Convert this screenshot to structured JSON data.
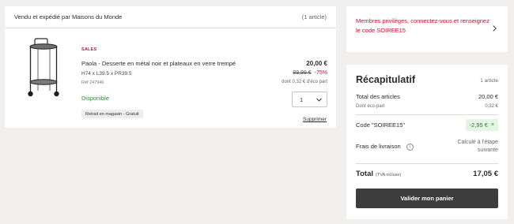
{
  "cart": {
    "seller": "Vendu et expédié par Maisons du Monde",
    "article_count": "(1 article)",
    "item": {
      "badge": "SALES",
      "name": "Paola - Desserte en métal noir et plateaux en verre trempé",
      "dimensions": "H74 x L39.5 x PR39.5",
      "reference": "Réf 247946",
      "availability": "Disponible",
      "pickup": "Retrait en magasin - Gratuit",
      "price": "20,00 €",
      "old_price": "89,99 €",
      "discount": "-75%",
      "eco_part": "dont 0,32 € d'éco part",
      "quantity": "1",
      "remove": "Supprimer"
    }
  },
  "promo": {
    "text": "Membres privilèges, connectez-vous et renseignez le code SOIREE15"
  },
  "summary": {
    "title": "Récapitulatif",
    "count": "1 article",
    "subtotal_label": "Total des articles",
    "subtotal_value": "20,00 €",
    "eco_label": "Dont éco-part",
    "eco_value": "0,32 €",
    "code_label": "Code \"SOIREE15\"",
    "code_value": "-2,95 €",
    "code_remove": "×",
    "shipping_label": "Frais de livraison",
    "shipping_info_icon": "i",
    "shipping_value": "Calculé à l'étape suivante",
    "total_label": "Total",
    "total_sub": "(TVA incluse)",
    "total_value": "17,05 €",
    "validate": "Valider mon panier"
  },
  "icons": {
    "product": "serving-cart-image",
    "quantity_chevron": "chevron-down-icon",
    "promo_chevron": "chevron-right-icon",
    "shipping_info": "info-icon"
  },
  "colors": {
    "accent_red": "#c8102e",
    "available_green": "#2e8b2e",
    "button_dark": "#3d3d3d"
  }
}
